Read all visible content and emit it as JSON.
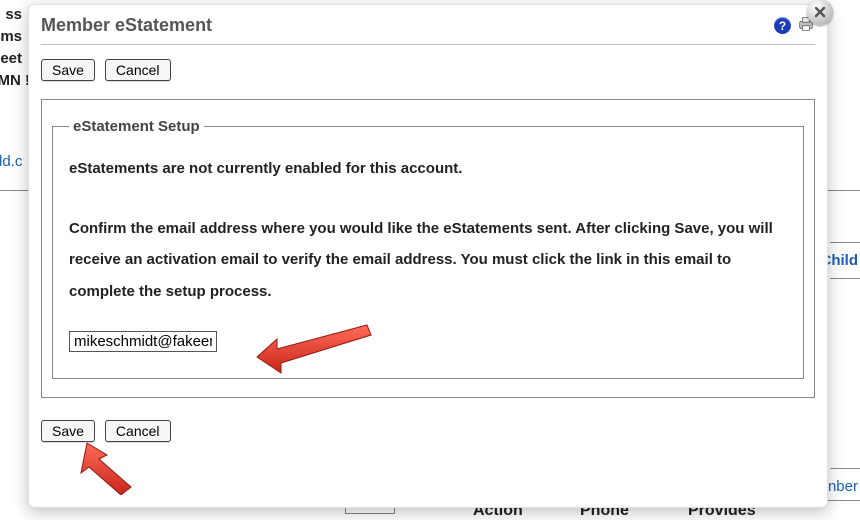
{
  "dialog": {
    "title": "Member eStatement",
    "save_label": "Save",
    "cancel_label": "Cancel"
  },
  "setup": {
    "legend": "eStatement Setup",
    "status_line": "eStatements are not currently enabled for this account.",
    "instructions": "Confirm the email address where you would like the eStatements sent. After clicking Save, you will receive an activation email to verify the email address. You must click the link in this email to complete the setup process.",
    "email_value": "mikeschmidt@fakeemail"
  },
  "background": {
    "frag1": "ss",
    "frag2": "ms",
    "frag3": "eet",
    "frag4": "MN !",
    "link_frag": "dd.c",
    "child_frag": "Child",
    "nber_frag": "nber",
    "col_action": "Action",
    "col_phone": "Phone",
    "col_provides": "Provides"
  }
}
